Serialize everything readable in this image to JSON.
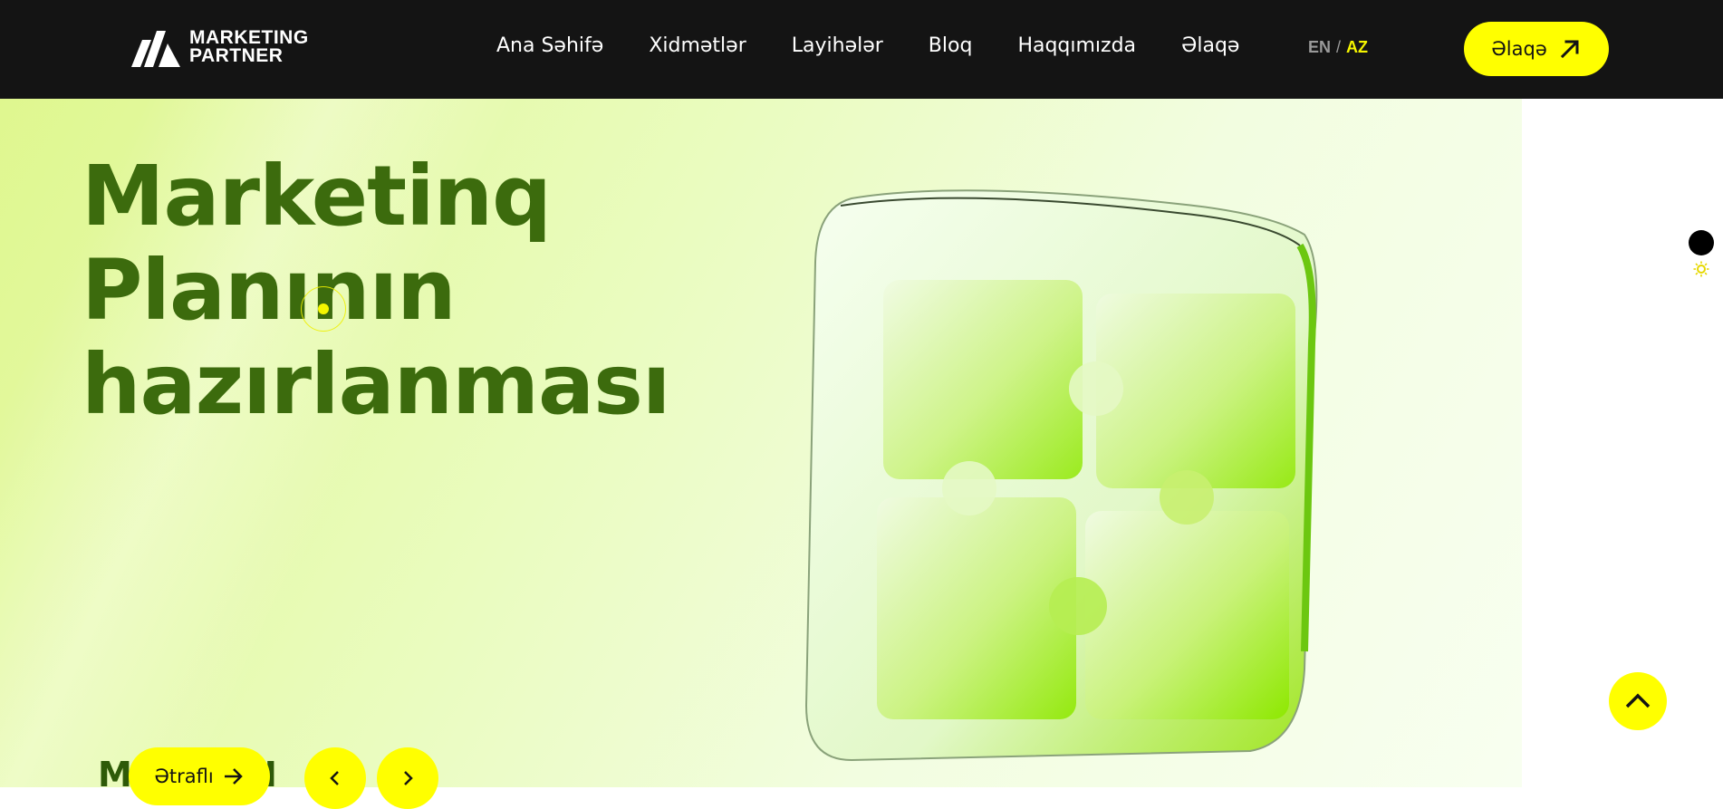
{
  "header": {
    "logo": {
      "line1": "MARKETING",
      "line2": "PARTNER"
    },
    "nav": [
      {
        "label": "Ana Səhifə"
      },
      {
        "label": "Xidmətlər"
      },
      {
        "label": "Layihələr"
      },
      {
        "label": "Bloq"
      },
      {
        "label": "Haqqımızda"
      },
      {
        "label": "Əlaqə"
      }
    ],
    "lang": {
      "en": "EN",
      "sep": "/",
      "az": "AZ",
      "active": "AZ"
    },
    "contact_button": {
      "label": "Əlaqə",
      "icon": "arrow-up-right-icon"
    }
  },
  "hero": {
    "title_lines": [
      "Marketinq",
      "Planının",
      "hazırlanması"
    ],
    "ghost_text": "MARKETI",
    "more_button": {
      "label": "Ətraflı",
      "icon": "arrow-right-icon"
    },
    "prev_icon": "chevron-left-icon",
    "next_icon": "chevron-right-icon",
    "image": "green-puzzle-icon"
  },
  "theme_toggle": {
    "icons": [
      "dark-mode-dot-icon",
      "sun-icon"
    ]
  },
  "scroll_top": {
    "icon": "chevron-up-icon"
  },
  "colors": {
    "header_bg": "#141414",
    "accent": "#ffff00",
    "title": "#3c6b0d",
    "hero_bg": "#e6fab0"
  }
}
